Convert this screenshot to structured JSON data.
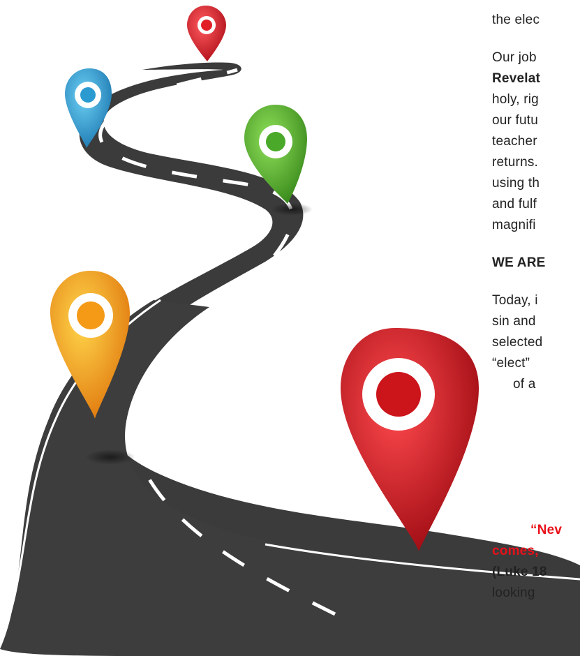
{
  "text_lines": {
    "l0": "the elec",
    "l1": "Our job",
    "l2": "Revelat",
    "l3": "holy, rig",
    "l4": "our futu",
    "l5": "teacher",
    "l6": "returns.",
    "l7": "using th",
    "l8": "and fulf",
    "l9": "magnifi",
    "heading": "WE ARE",
    "l11": "Today, i",
    "l12": "sin and",
    "l13": "selected",
    "l14": "“elect”",
    "l15": "of a",
    "quote1": "“Nev",
    "quote2": "comes,",
    "ref": "(Luke 18",
    "l19": "looking"
  },
  "colors": {
    "road": "#3b3b3b",
    "text": "#222222",
    "quote_red": "#e8111b",
    "pin_red_top": "#d61f26",
    "pin_blue": "#29a3d6",
    "pin_green": "#55b42e",
    "pin_yellow": "#f7a81b",
    "pin_red_large": "#d4151d"
  },
  "icons": [
    "map-pin-icon-red",
    "map-pin-icon-blue",
    "map-pin-icon-green",
    "map-pin-icon-yellow",
    "map-pin-icon-red-large"
  ]
}
